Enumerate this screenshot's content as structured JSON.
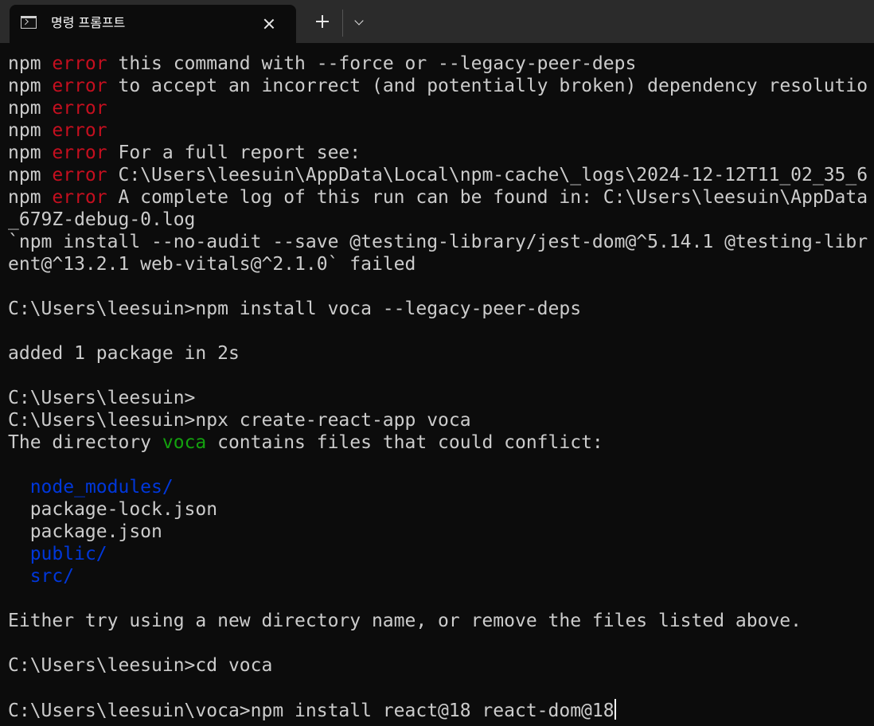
{
  "tab": {
    "title": "명령 프롬프트",
    "icon": "terminal-icon"
  },
  "toolbar": {
    "close_icon": "close-icon",
    "new_tab_icon": "plus-icon",
    "dropdown_icon": "chevron-down-icon"
  },
  "colors": {
    "background": "#0c0c0c",
    "tabbar": "#2b2b2b",
    "text": "#cccccc",
    "error": "#c50f1f",
    "dir_name": "#13a10e",
    "folder": "#0037da"
  },
  "terminal": {
    "lines": [
      [
        {
          "t": "npm "
        },
        {
          "t": "error",
          "c": "red"
        },
        {
          "t": " this command with --force or --legacy-peer-deps"
        }
      ],
      [
        {
          "t": "npm "
        },
        {
          "t": "error",
          "c": "red"
        },
        {
          "t": " to accept an incorrect (and potentially broken) dependency resolutio"
        }
      ],
      [
        {
          "t": "npm "
        },
        {
          "t": "error",
          "c": "red"
        }
      ],
      [
        {
          "t": "npm "
        },
        {
          "t": "error",
          "c": "red"
        }
      ],
      [
        {
          "t": "npm "
        },
        {
          "t": "error",
          "c": "red"
        },
        {
          "t": " For a full report see:"
        }
      ],
      [
        {
          "t": "npm "
        },
        {
          "t": "error",
          "c": "red"
        },
        {
          "t": " C:\\Users\\leesuin\\AppData\\Local\\npm-cache\\_logs\\2024-12-12T11_02_35_6"
        }
      ],
      [
        {
          "t": "npm "
        },
        {
          "t": "error",
          "c": "red"
        },
        {
          "t": " A complete log of this run can be found in: C:\\Users\\leesuin\\AppData"
        }
      ],
      [
        {
          "t": "_679Z-debug-0.log"
        }
      ],
      [
        {
          "t": "`npm install --no-audit --save @testing-library/jest-dom@^5.14.1 @testing-libr"
        }
      ],
      [
        {
          "t": "ent@^13.2.1 web-vitals@^2.1.0` failed"
        }
      ],
      [],
      [
        {
          "t": "C:\\Users\\leesuin>npm install voca --legacy-peer-deps"
        }
      ],
      [],
      [
        {
          "t": "added 1 package in 2s"
        }
      ],
      [],
      [
        {
          "t": "C:\\Users\\leesuin>"
        }
      ],
      [
        {
          "t": "C:\\Users\\leesuin>npx create-react-app voca"
        }
      ],
      [
        {
          "t": "The directory "
        },
        {
          "t": "voca",
          "c": "green"
        },
        {
          "t": " contains files that could conflict:"
        }
      ],
      [],
      [
        {
          "t": "  "
        },
        {
          "t": "node_modules/",
          "c": "blue"
        }
      ],
      [
        {
          "t": "  package-lock.json"
        }
      ],
      [
        {
          "t": "  package.json"
        }
      ],
      [
        {
          "t": "  "
        },
        {
          "t": "public/",
          "c": "blue"
        }
      ],
      [
        {
          "t": "  "
        },
        {
          "t": "src/",
          "c": "blue"
        }
      ],
      [],
      [
        {
          "t": "Either try using a new directory name, or remove the files listed above."
        }
      ],
      [],
      [
        {
          "t": "C:\\Users\\leesuin>cd voca"
        }
      ],
      [],
      [
        {
          "t": "C:\\Users\\leesuin\\voca>npm install react@18 react-dom@18"
        }
      ]
    ]
  }
}
